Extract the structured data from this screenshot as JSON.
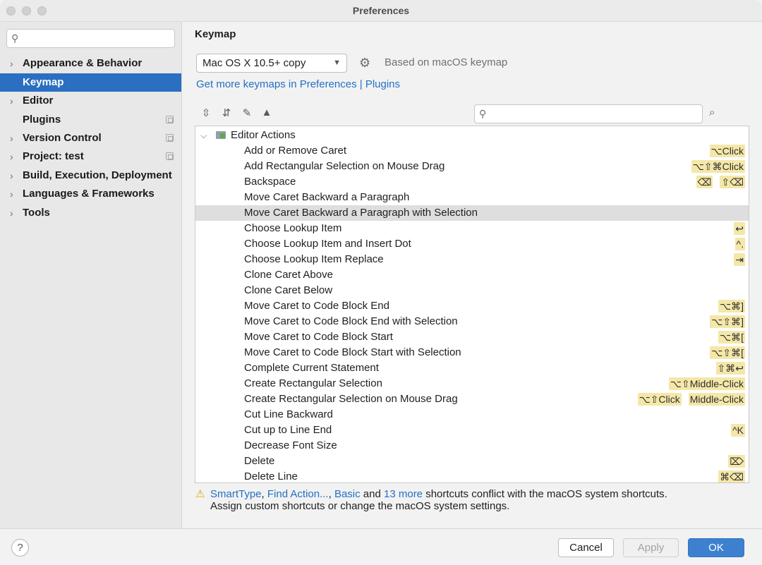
{
  "window": {
    "title": "Preferences"
  },
  "sidebar": {
    "search_placeholder": "",
    "items": [
      {
        "label": "Appearance & Behavior",
        "expandable": true,
        "selected": false,
        "project": false
      },
      {
        "label": "Keymap",
        "expandable": false,
        "selected": true,
        "project": false
      },
      {
        "label": "Editor",
        "expandable": true,
        "selected": false,
        "project": false
      },
      {
        "label": "Plugins",
        "expandable": false,
        "selected": false,
        "project": true
      },
      {
        "label": "Version Control",
        "expandable": true,
        "selected": false,
        "project": true
      },
      {
        "label": "Project: test",
        "expandable": true,
        "selected": false,
        "project": true
      },
      {
        "label": "Build, Execution, Deployment",
        "expandable": true,
        "selected": false,
        "project": false
      },
      {
        "label": "Languages & Frameworks",
        "expandable": true,
        "selected": false,
        "project": false
      },
      {
        "label": "Tools",
        "expandable": true,
        "selected": false,
        "project": false
      }
    ]
  },
  "main": {
    "title": "Keymap",
    "keymap_select": "Mac OS X 10.5+ copy",
    "based_on": "Based on macOS keymap",
    "get_more_link": "Get more keymaps in Preferences | Plugins",
    "toolbar_icons": [
      "expand-all-icon",
      "collapse-all-icon",
      "edit-icon",
      "warning-icon"
    ],
    "find_placeholder": "",
    "tree": {
      "root_label": "Editor Actions",
      "rows": [
        {
          "label": "Add or Remove Caret",
          "keys": [
            "⌥Click"
          ]
        },
        {
          "label": "Add Rectangular Selection on Mouse Drag",
          "keys": [
            "⌥⇧⌘Click"
          ]
        },
        {
          "label": "Backspace",
          "keys": [
            "⌫",
            "⇧⌫"
          ]
        },
        {
          "label": "Move Caret Backward a Paragraph",
          "keys": []
        },
        {
          "label": "Move Caret Backward a Paragraph with Selection",
          "keys": [],
          "selected": true
        },
        {
          "label": "Choose Lookup Item",
          "keys": [
            "↩"
          ]
        },
        {
          "label": "Choose Lookup Item and Insert Dot",
          "keys": [
            "^."
          ]
        },
        {
          "label": "Choose Lookup Item Replace",
          "keys": [
            "⇥"
          ]
        },
        {
          "label": "Clone Caret Above",
          "keys": []
        },
        {
          "label": "Clone Caret Below",
          "keys": []
        },
        {
          "label": "Move Caret to Code Block End",
          "keys": [
            "⌥⌘]"
          ]
        },
        {
          "label": "Move Caret to Code Block End with Selection",
          "keys": [
            "⌥⇧⌘]"
          ]
        },
        {
          "label": "Move Caret to Code Block Start",
          "keys": [
            "⌥⌘["
          ]
        },
        {
          "label": "Move Caret to Code Block Start with Selection",
          "keys": [
            "⌥⇧⌘["
          ]
        },
        {
          "label": "Complete Current Statement",
          "keys": [
            "⇧⌘↩"
          ]
        },
        {
          "label": "Create Rectangular Selection",
          "keys": [
            "⌥⇧Middle-Click"
          ]
        },
        {
          "label": "Create Rectangular Selection on Mouse Drag",
          "keys": [
            "⌥⇧Click",
            "Middle-Click"
          ]
        },
        {
          "label": "Cut Line Backward",
          "keys": []
        },
        {
          "label": "Cut up to Line End",
          "keys": [
            "^K"
          ]
        },
        {
          "label": "Decrease Font Size",
          "keys": []
        },
        {
          "label": "Delete",
          "keys": [
            "⌦"
          ]
        },
        {
          "label": "Delete Line",
          "keys": [
            "⌘⌫"
          ]
        }
      ]
    },
    "warning": {
      "link1": "SmartType",
      "sep1": ", ",
      "link2": "Find Action...",
      "sep2": ", ",
      "link3": "Basic",
      "and": " and ",
      "link4": "13 more",
      "rest1": " shortcuts conflict with the macOS system shortcuts.",
      "line2": "Assign custom shortcuts or change the macOS system settings."
    }
  },
  "footer": {
    "help": "?",
    "cancel": "Cancel",
    "apply": "Apply",
    "ok": "OK"
  },
  "colors": {
    "selection": "#2a6fc2",
    "link": "#2470c4",
    "shortcut_bg": "#f4e7a8",
    "ok_button": "#3d80cf"
  }
}
